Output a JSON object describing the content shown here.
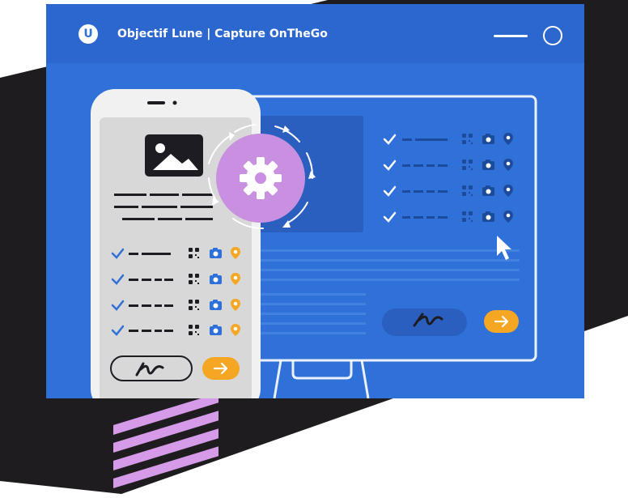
{
  "header": {
    "logo_letter": "U",
    "title": "Objectif Lune | Capture OnTheGo"
  },
  "icons": {
    "logo": "capture-onthego-logo-icon",
    "menu": "menu-line-icon",
    "circle": "circle-icon",
    "image": "image-placeholder-icon",
    "settings": "gear-icon",
    "sync": "sync-arrows-icon",
    "check": "checkmark-icon",
    "qr": "qr-code-icon",
    "camera": "camera-icon",
    "location": "location-pin-icon",
    "signature": "signature-icon",
    "submit": "arrow-right-icon",
    "cursor": "mouse-pointer-icon"
  },
  "colors": {
    "brand_blue": "#2f70d9",
    "accent_orange": "#f5a623",
    "gear_purple": "#c98fe0",
    "dark_band": "#1f1c1f"
  }
}
